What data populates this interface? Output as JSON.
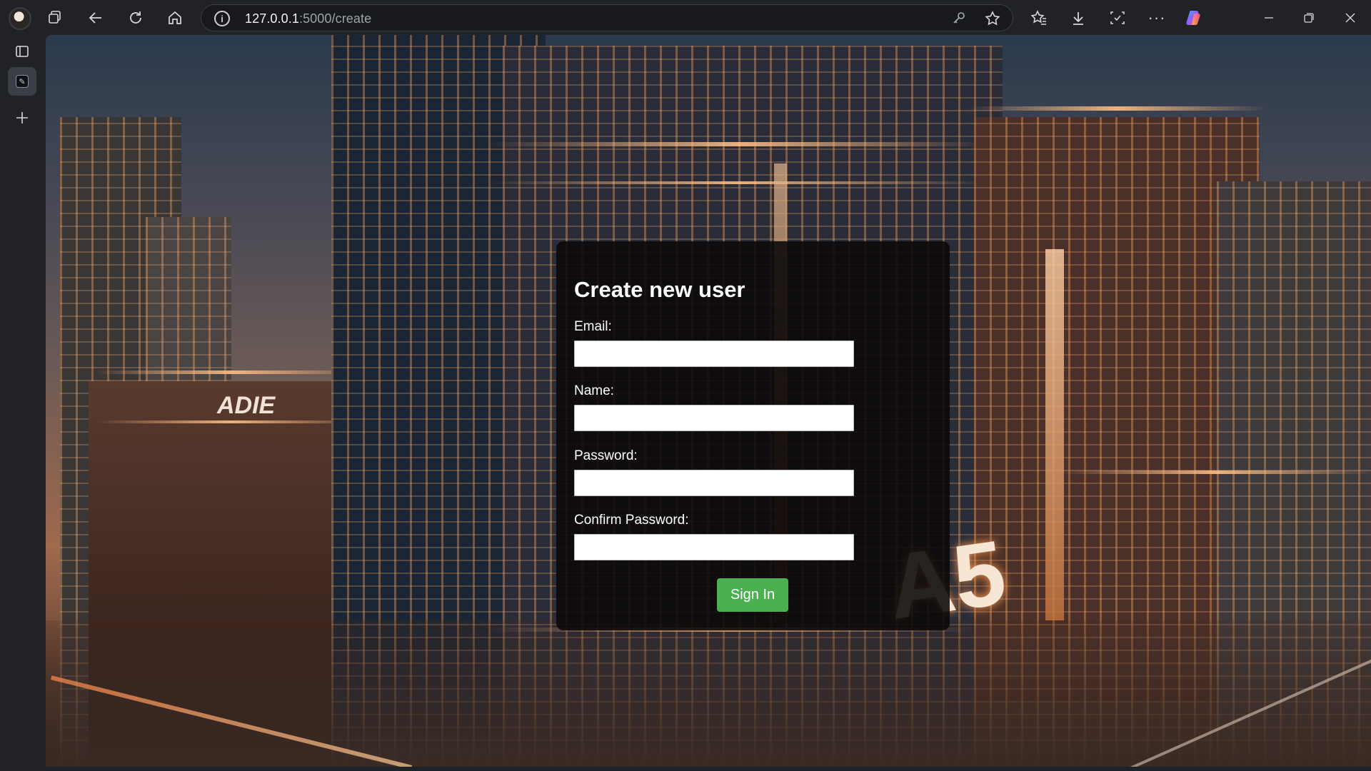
{
  "browser": {
    "url_host": "127.0.0.1",
    "url_path": ":5000/create",
    "icons": [
      "profile-avatar",
      "workspaces-icon",
      "back-icon",
      "refresh-icon",
      "home-icon",
      "site-info-icon",
      "password-key-icon",
      "favorite-star-icon",
      "favorites-icon",
      "download-icon",
      "screenshot-icon",
      "more-icon",
      "copilot-icon",
      "minimize-icon",
      "restore-icon",
      "close-icon"
    ],
    "sidebar_icons": [
      "tab-actions-icon",
      "active-tab-icon",
      "new-tab-icon"
    ]
  },
  "form": {
    "title": "Create new user",
    "fields": [
      {
        "label": "Email:",
        "value": "",
        "type": "email"
      },
      {
        "label": "Name:",
        "value": "",
        "type": "text"
      },
      {
        "label": "Password:",
        "value": "",
        "type": "password"
      },
      {
        "label": "Confirm Password:",
        "value": "",
        "type": "password"
      }
    ],
    "submit_label": "Sign In",
    "submit_color": "#4caf50"
  },
  "background": {
    "description_sign": "A5"
  }
}
